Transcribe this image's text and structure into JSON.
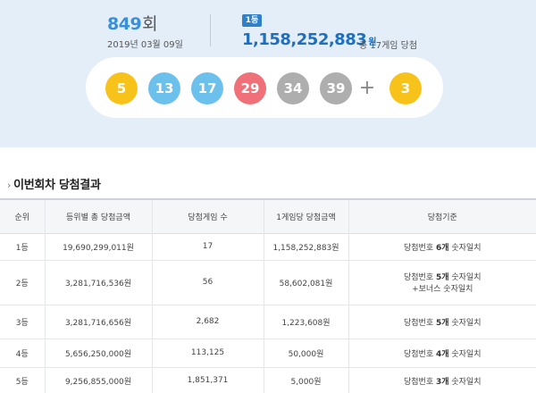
{
  "draw": {
    "round": "849",
    "round_suffix": "회",
    "date": "2019년 03월 09일",
    "rank_badge": "1등",
    "first_prize": "1,158,252,883",
    "first_prize_unit": "원",
    "winners_note": "총 17게임 당첨"
  },
  "balls": [
    {
      "number": "5",
      "color": "#f7c31b"
    },
    {
      "number": "13",
      "color": "#6cc1ec"
    },
    {
      "number": "17",
      "color": "#6cc1ec"
    },
    {
      "number": "29",
      "color": "#f0707a"
    },
    {
      "number": "34",
      "color": "#aeaeae"
    },
    {
      "number": "39",
      "color": "#aeaeae"
    }
  ],
  "plus_sign": "+",
  "bonus_ball": {
    "number": "3",
    "color": "#f7c31b"
  },
  "section": {
    "chevron": "›",
    "title": "이번회차 당첨결과"
  },
  "table": {
    "headers": [
      "순위",
      "등위별 총 당첨금액",
      "당첨게임 수",
      "1게임당 당첨금액",
      "당첨기준"
    ],
    "rows": [
      {
        "rank": "1등",
        "total": "19,690,299,011원",
        "games": "17",
        "per_game": "1,158,252,883원",
        "crit_pre": "당첨번호 ",
        "crit_bold": "6개",
        "crit_post": " 숫자일치",
        "crit_line2": ""
      },
      {
        "rank": "2등",
        "total": "3,281,716,536원",
        "games": "56",
        "per_game": "58,602,081원",
        "crit_pre": "당첨번호 ",
        "crit_bold": "5개",
        "crit_post": " 숫자일치",
        "crit_line2": "+보너스 숫자일치"
      },
      {
        "rank": "3등",
        "total": "3,281,716,656원",
        "games": "2,682",
        "per_game": "1,223,608원",
        "crit_pre": "당첨번호 ",
        "crit_bold": "5개",
        "crit_post": " 숫자일치",
        "crit_line2": ""
      },
      {
        "rank": "4등",
        "total": "5,656,250,000원",
        "games": "113,125",
        "per_game": "50,000원",
        "crit_pre": "당첨번호 ",
        "crit_bold": "4개",
        "crit_post": " 숫자일치",
        "crit_line2": ""
      },
      {
        "rank": "5등",
        "total": "9,256,855,000원",
        "games": "1,851,371",
        "per_game": "5,000원",
        "crit_pre": "당첨번호 ",
        "crit_bold": "3개",
        "crit_post": " 숫자일치",
        "crit_line2": ""
      }
    ]
  }
}
